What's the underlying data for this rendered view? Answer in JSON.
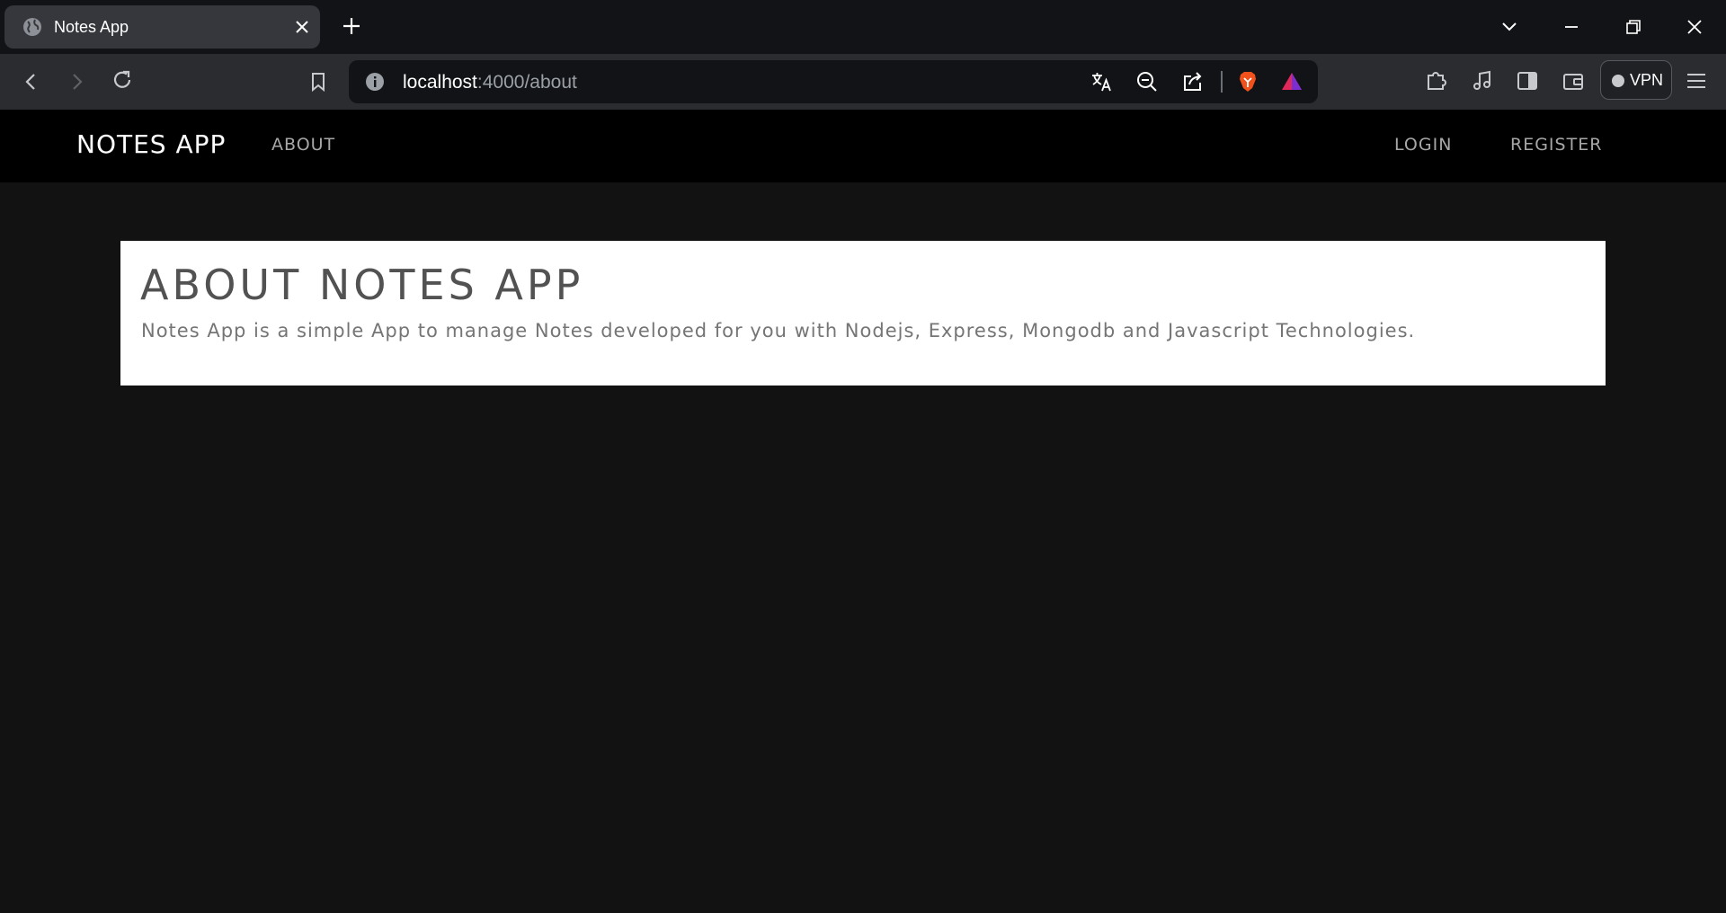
{
  "browser": {
    "tab": {
      "title": "Notes App",
      "favicon": "globe-icon"
    },
    "address": {
      "host": "localhost",
      "path": ":4000/about"
    },
    "vpn_label": "VPN"
  },
  "navbar": {
    "brand": "NOTES APP",
    "links": {
      "about": "ABOUT",
      "login": "LOGIN",
      "register": "REGISTER"
    }
  },
  "about": {
    "heading": "ABOUT NOTES APP",
    "description": "Notes App is a simple App to manage Notes developed for you with Nodejs, Express, Mongodb and Javascript Technologies."
  },
  "colors": {
    "page_background": "#121212",
    "navbar_background": "#000000",
    "card_background": "#ffffff",
    "heading_text": "#525252",
    "body_text": "#757575",
    "nav_link": "#a7a7a7"
  }
}
